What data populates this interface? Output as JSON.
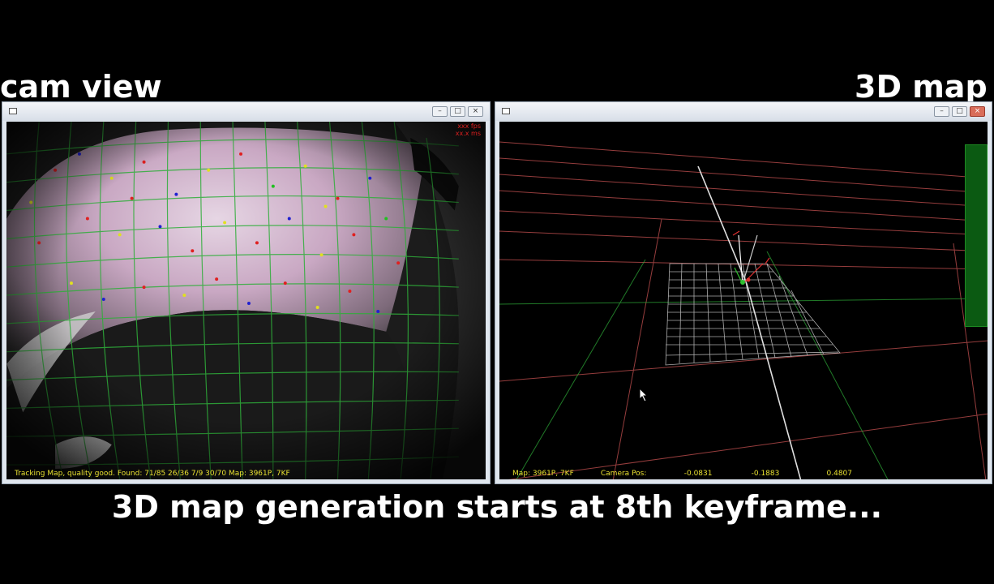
{
  "overlay": {
    "left_title": "cam view",
    "right_title": "3D map",
    "caption": "3D map generation starts at 8th keyframe..."
  },
  "camera_window": {
    "fps_line1": "xxx fps",
    "fps_line2": "xx.x ms",
    "status": "Tracking Map, quality good. Found: 71/85 26/36 7/9 30/70 Map: 3961P, 7KF"
  },
  "map_window": {
    "map_label": "Map: 3961P, 7KF",
    "camera_pos_label": "Camera Pos:",
    "pos_x": "-0.0831",
    "pos_y": "-0.1883",
    "pos_z": "0.4807"
  },
  "window_buttons": [
    "minimize-icon",
    "maximize-icon",
    "close-icon"
  ],
  "colors": {
    "grid_green": "#2fae3a",
    "grid_red": "#b04848",
    "status_yellow": "#e8e030",
    "patch_white": "#e8e8e8"
  }
}
